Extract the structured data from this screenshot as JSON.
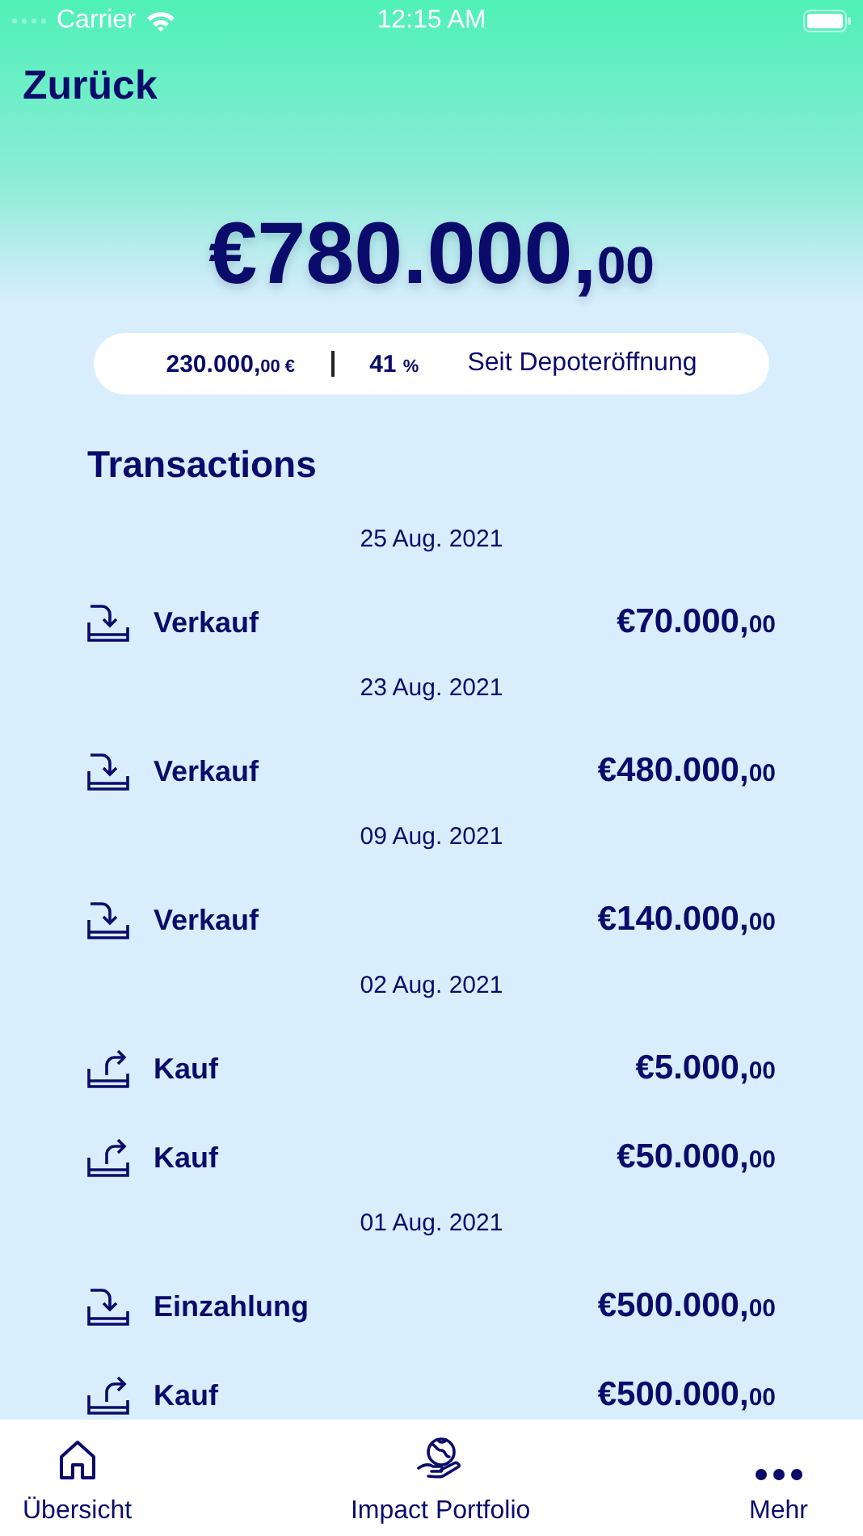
{
  "status_bar": {
    "carrier": "Carrier",
    "time": "12:15 AM"
  },
  "nav": {
    "back": "Zurück"
  },
  "balance": {
    "amount": "€780.000,",
    "fraction": "00"
  },
  "performance": {
    "amount": "230.000,",
    "fraction": "00 €",
    "percent": "41",
    "percent_unit": "%",
    "period": "Seit Depoteröffnung"
  },
  "transactions": {
    "title": "Transactions",
    "groups": [
      {
        "date": "25 Aug. 2021",
        "items": [
          {
            "kind": "incoming",
            "label": "Verkauf",
            "amount": "€70.000,",
            "fraction": "00"
          }
        ]
      },
      {
        "date": "23 Aug. 2021",
        "items": [
          {
            "kind": "incoming",
            "label": "Verkauf",
            "amount": "€480.000,",
            "fraction": "00"
          }
        ]
      },
      {
        "date": "09 Aug. 2021",
        "items": [
          {
            "kind": "incoming",
            "label": "Verkauf",
            "amount": "€140.000,",
            "fraction": "00"
          }
        ]
      },
      {
        "date": "02 Aug. 2021",
        "items": [
          {
            "kind": "outgoing",
            "label": "Kauf",
            "amount": "€5.000,",
            "fraction": "00"
          },
          {
            "kind": "outgoing",
            "label": "Kauf",
            "amount": "€50.000,",
            "fraction": "00"
          }
        ]
      },
      {
        "date": "01 Aug. 2021",
        "items": [
          {
            "kind": "incoming",
            "label": "Einzahlung",
            "amount": "€500.000,",
            "fraction": "00"
          },
          {
            "kind": "outgoing",
            "label": "Kauf",
            "amount": "€500.000,",
            "fraction": "00"
          }
        ]
      }
    ]
  },
  "tab_bar": [
    {
      "kind": "home",
      "label": "Übersicht"
    },
    {
      "kind": "impact",
      "label": "Impact Portfolio"
    },
    {
      "kind": "more",
      "label": "Mehr"
    }
  ]
}
